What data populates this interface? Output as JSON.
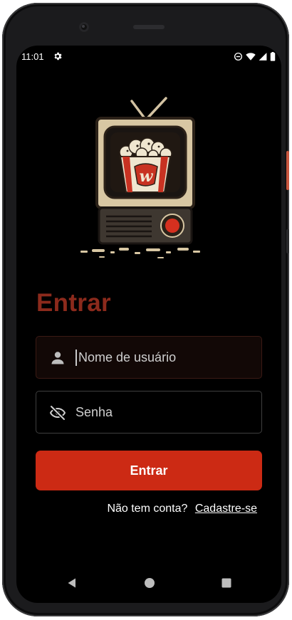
{
  "status_bar": {
    "time": "11:01",
    "icons": [
      "gear-icon",
      "do-not-disturb-icon",
      "wifi-icon",
      "signal-icon",
      "battery-icon"
    ]
  },
  "login": {
    "title": "Entrar",
    "username": {
      "value": "",
      "placeholder": "Nome de usuário",
      "icon": "person-icon"
    },
    "password": {
      "value": "",
      "placeholder": "Senha",
      "icon": "eye-off-icon"
    },
    "submit_label": "Entrar",
    "no_account_text": "Não tem conta?",
    "signup_link": "Cadastre-se"
  },
  "nav_bar": {
    "icons": [
      "back-icon",
      "home-icon",
      "recents-icon"
    ]
  },
  "colors": {
    "background": "#000000",
    "title": "#8c2a1c",
    "button": "#cc2a14",
    "text": "#ffffff"
  }
}
